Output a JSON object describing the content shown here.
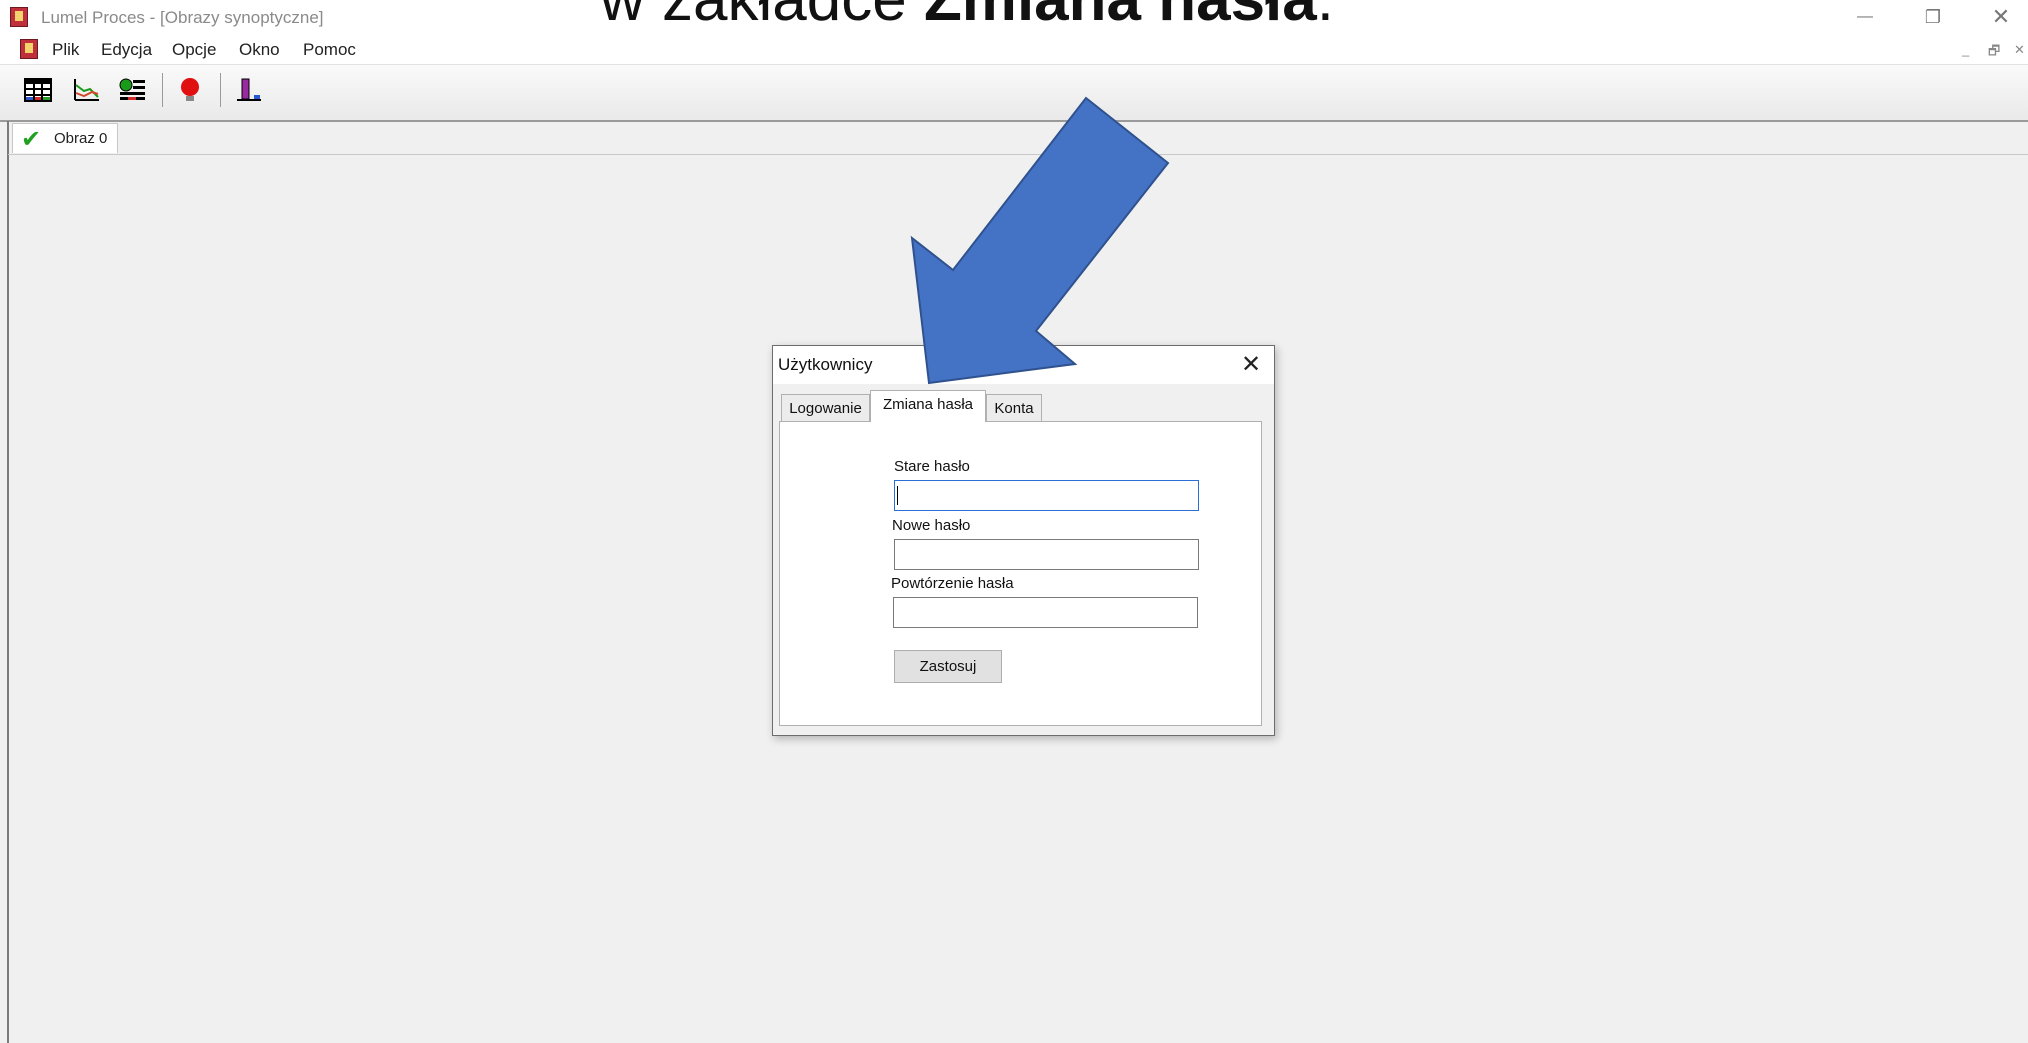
{
  "window": {
    "title": "Lumel Proces - [Obrazy synoptyczne]",
    "controls": {
      "minimize": "—",
      "restore": "❐",
      "close": "✕"
    }
  },
  "headline": {
    "prefix": "w zakładce ",
    "bold": "Zmiana hasła",
    "suffix": "."
  },
  "menubar": {
    "items": [
      "Plik",
      "Edycja",
      "Opcje",
      "Okno",
      "Pomoc"
    ],
    "mdi_controls": {
      "minimize": "_",
      "restore": "🗗",
      "close": "✕"
    }
  },
  "toolbar": {
    "icons": [
      "table-icon",
      "chart-icon",
      "list-icon",
      "alarm-bulb-icon",
      "bar-graph-icon"
    ]
  },
  "doc_tab": {
    "label": "Obraz 0",
    "icon": "check-icon"
  },
  "dialog": {
    "title": "Użytkownicy",
    "close": "✕",
    "tabs": [
      "Logowanie",
      "Zmiana hasła",
      "Konta"
    ],
    "active_tab": "Zmiana hasła",
    "fields": {
      "old_password_label": "Stare hasło",
      "new_password_label": "Nowe hasło",
      "repeat_password_label": "Powtórzenie hasła",
      "old_password_value": "",
      "new_password_value": "",
      "repeat_password_value": ""
    },
    "apply_label": "Zastosuj"
  },
  "colors": {
    "arrow_fill": "#4472c4",
    "arrow_stroke": "#2f528f",
    "focus_border": "#2a6fd6",
    "check": "#22a022"
  }
}
